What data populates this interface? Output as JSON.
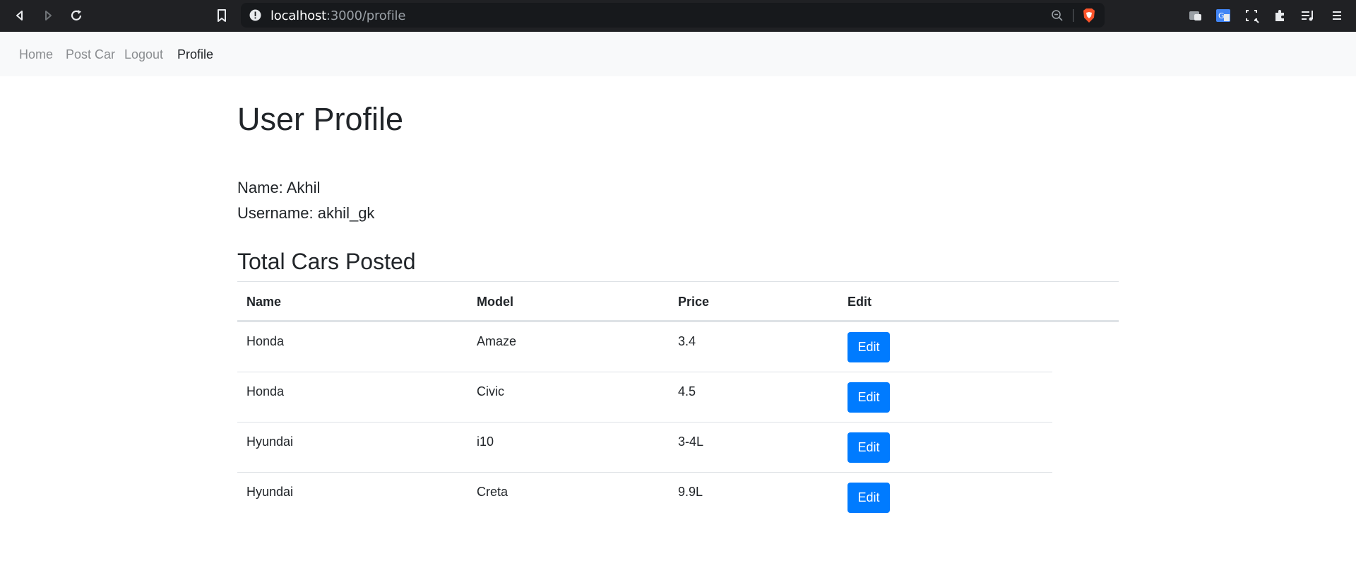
{
  "browser": {
    "url_host": "localhost",
    "url_path": ":3000/profile"
  },
  "navbar": {
    "links": [
      "Home",
      "Post Car",
      "Logout",
      "Profile"
    ],
    "active": "Profile"
  },
  "profile": {
    "title": "User Profile",
    "name_line": "Name: Akhil",
    "username_line": "Username: akhil_gk"
  },
  "cars": {
    "section_title": "Total Cars Posted",
    "headers": [
      "Name",
      "Model",
      "Price",
      "Edit"
    ],
    "rows": [
      {
        "name": "Honda",
        "model": "Amaze",
        "price": "3.4",
        "edit": "Edit"
      },
      {
        "name": "Honda",
        "model": "Civic",
        "price": "4.5",
        "edit": "Edit"
      },
      {
        "name": "Hyundai",
        "model": "i10",
        "price": "3-4L",
        "edit": "Edit"
      },
      {
        "name": "Hyundai",
        "model": "Creta",
        "price": "9.9L",
        "edit": "Edit"
      }
    ]
  },
  "colors": {
    "primary": "#007bff",
    "navbar_bg": "#f8f9fa",
    "browser_bg": "#202124"
  }
}
